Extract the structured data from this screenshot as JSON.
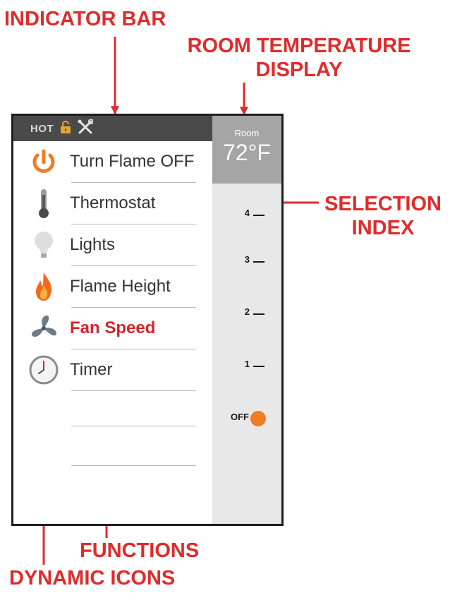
{
  "callouts": {
    "indicator_bar": "INDICATOR BAR",
    "room_temp_line1": "ROOM TEMPERATURE",
    "room_temp_line2": "DISPLAY",
    "selection_line1": "SELECTION",
    "selection_line2": "INDEX",
    "functions": "FUNCTIONS",
    "dynamic_icons": "DYNAMIC ICONS"
  },
  "indicator_bar": {
    "status": "HOT",
    "icons": [
      "lock-icon",
      "tools-icon"
    ]
  },
  "menu": [
    {
      "label": "Turn Flame OFF",
      "icon": "power-icon",
      "active": false
    },
    {
      "label": "Thermostat",
      "icon": "thermometer-icon",
      "active": false
    },
    {
      "label": "Lights",
      "icon": "lightbulb-icon",
      "active": false
    },
    {
      "label": "Flame Height",
      "icon": "flame-icon",
      "active": false
    },
    {
      "label": "Fan Speed",
      "icon": "fan-icon",
      "active": true
    },
    {
      "label": "Timer",
      "icon": "clock-icon",
      "active": false
    }
  ],
  "room": {
    "label": "Room",
    "temperature": "72°F"
  },
  "selection_index": {
    "levels": [
      "4",
      "3",
      "2",
      "1"
    ],
    "off_label": "OFF",
    "current": "OFF"
  },
  "colors": {
    "callout": "#e02b2b",
    "active_label": "#d6242b",
    "power_icon": "#ef7d22",
    "off_indicator": "#ef7d22",
    "indicator_bar": "#4a4a4a",
    "room_box": "#a5a5a5",
    "side_panel": "#e8e8e8"
  }
}
